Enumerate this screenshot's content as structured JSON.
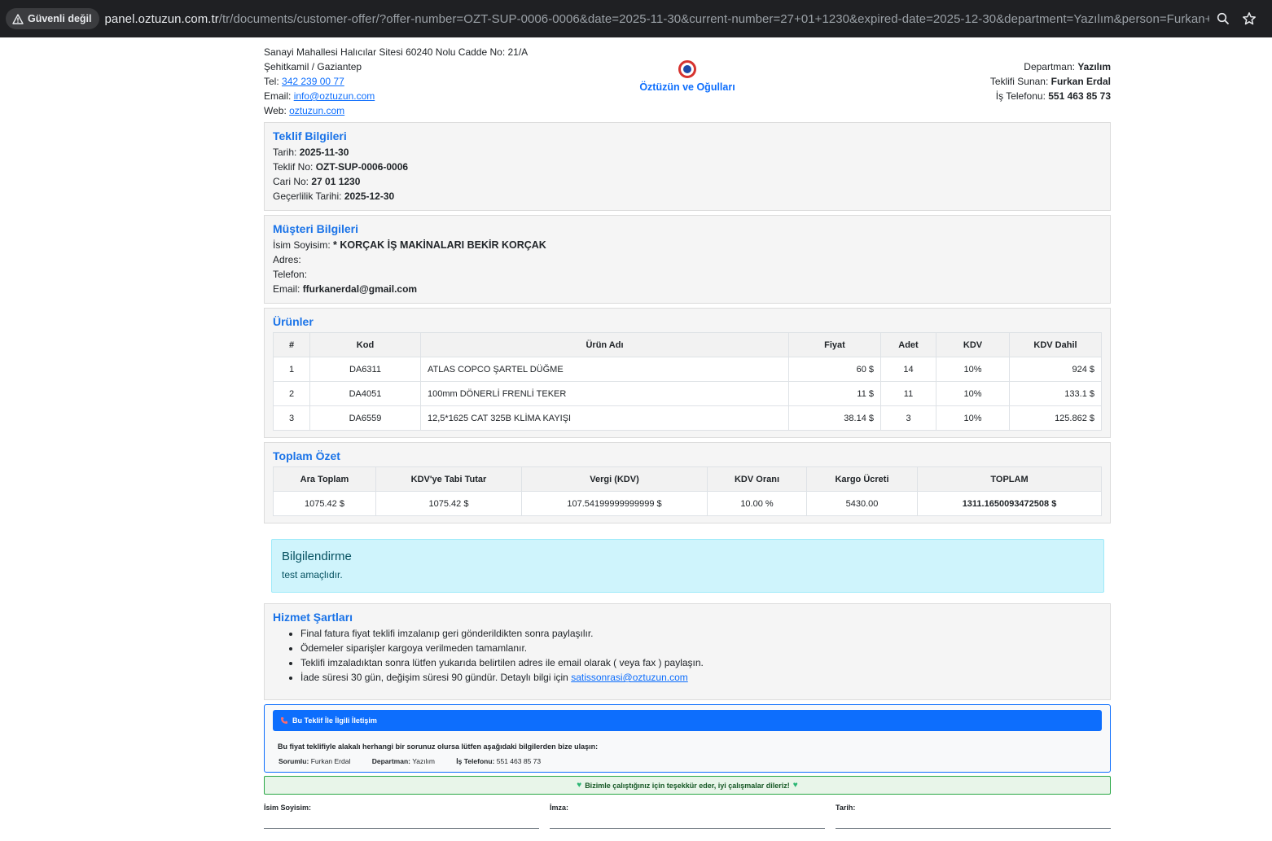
{
  "browser": {
    "security_label": "Güvenli değil",
    "url_host": "panel.oztuzun.com.tr",
    "url_path": "/tr/documents/customer-offer/?offer-number=OZT-SUP-0006-0006&date=2025-11-30&current-number=27+01+1230&expired-date=2025-12-30&department=Yazılım&person=Furkan+Erdal&na..."
  },
  "company": {
    "address1": "Sanayi Mahallesi Halıcılar Sitesi 60240 Nolu Cadde No: 21/A",
    "address2": "Şehitkamil / Gaziantep",
    "tel_label": "Tel: ",
    "tel": "342 239 00 77",
    "email_label": "Email: ",
    "email": "info@oztuzun.com",
    "web_label": "Web: ",
    "web": "oztuzun.com",
    "logo_text": "ÖZTÜZÜN",
    "name": "Öztüzün ve Oğulları"
  },
  "header_right": {
    "department_label": "Departman: ",
    "department": "Yazılım",
    "presenter_label": "Teklifi Sunan: ",
    "presenter": "Furkan Erdal",
    "work_phone_label": "İş Telefonu: ",
    "work_phone": "551 463 85 73"
  },
  "offer": {
    "title": "Teklif Bilgileri",
    "date_label": "Tarih: ",
    "date": "2025-11-30",
    "no_label": "Teklif No: ",
    "no": "OZT-SUP-0006-0006",
    "current_label": "Cari No: ",
    "current": "27 01 1230",
    "validity_label": "Geçerlilik Tarihi: ",
    "validity": "2025-12-30"
  },
  "customer": {
    "title": "Müşteri Bilgileri",
    "name_label": "İsim Soyisim: ",
    "name": "* KORÇAK İŞ MAKİNALARI BEKİR KORÇAK",
    "address_label": "Adres:",
    "phone_label": "Telefon:",
    "email_label": "Email: ",
    "email": "ffurkanerdal@gmail.com"
  },
  "products": {
    "title": "Ürünler",
    "headers": [
      "#",
      "Kod",
      "Ürün Adı",
      "Fiyat",
      "Adet",
      "KDV",
      "KDV Dahil"
    ],
    "rows": [
      {
        "no": "1",
        "code": "DA6311",
        "name": "ATLAS COPCO ŞARTEL DÜĞME",
        "price": "60 $",
        "qty": "14",
        "vat": "10%",
        "total": "924 $"
      },
      {
        "no": "2",
        "code": "DA4051",
        "name": "100mm DÖNERLİ FRENLİ TEKER",
        "price": "11 $",
        "qty": "11",
        "vat": "10%",
        "total": "133.1 $"
      },
      {
        "no": "3",
        "code": "DA6559",
        "name": "12,5*1625 CAT 325B KLİMA KAYIŞI",
        "price": "38.14 $",
        "qty": "3",
        "vat": "10%",
        "total": "125.862 $"
      }
    ]
  },
  "summary": {
    "title": "Toplam Özet",
    "headers": [
      "Ara Toplam",
      "KDV'ye Tabi Tutar",
      "Vergi (KDV)",
      "KDV Oranı",
      "Kargo Ücreti",
      "TOPLAM"
    ],
    "values": [
      "1075.42 $",
      "1075.42 $",
      "107.54199999999999 $",
      "10.00 %",
      "5430.00",
      "1311.1650093472508 $"
    ]
  },
  "notice": {
    "title": "Bilgilendirme",
    "text": "test amaçlıdır."
  },
  "terms": {
    "title": "Hizmet Şartları",
    "items": [
      "Final fatura fiyat teklifi imzalanıp geri gönderildikten sonra paylaşılır.",
      "Ödemeler siparişler kargoya verilmeden tamamlanır.",
      "Teklifi imzaladıktan sonra lütfen yukarıda belirtilen adres ile email olarak ( veya fax ) paylaşın.",
      "İade süresi 30 gün, değişim süresi 90 gündür. Detaylı bilgi için "
    ],
    "after_sales_email": "satissonrasi@oztuzun.com"
  },
  "contact": {
    "title": "Bu Teklif İle İlgili İletişim",
    "message": "Bu fiyat teklifiyle alakalı herhangi bir sorunuz olursa lütfen aşağıdaki bilgilerden bize ulaşın:",
    "responsible_label": "Sorumlu:",
    "responsible": "Furkan Erdal",
    "department_label": "Departman:",
    "department": "Yazılım",
    "phone_label": "İş Telefonu:",
    "phone": "551 463 85 73"
  },
  "thanks": "Bizimle çalıştığınız için teşekkür eder, iyi çalışmalar dileriz!",
  "signature": {
    "name_label": "İsim Soyisim:",
    "sign_label": "İmza:",
    "date_label": "Tarih:"
  },
  "colors": {
    "accent": "#0d6efd",
    "heading": "#1a73e8",
    "info_bg": "#cff4fc",
    "success_border": "#28a745"
  }
}
